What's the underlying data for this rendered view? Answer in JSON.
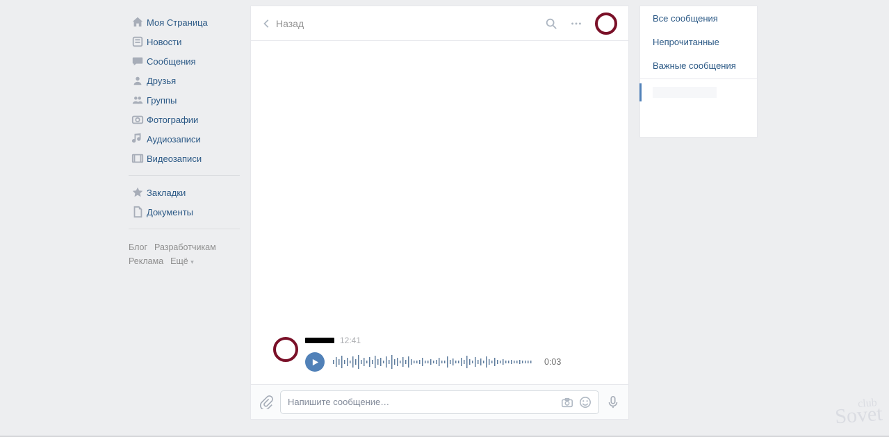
{
  "nav": {
    "items": [
      {
        "label": "Моя Страница",
        "icon": "home-icon"
      },
      {
        "label": "Новости",
        "icon": "feed-icon"
      },
      {
        "label": "Сообщения",
        "icon": "messages-icon"
      },
      {
        "label": "Друзья",
        "icon": "friends-icon"
      },
      {
        "label": "Группы",
        "icon": "groups-icon"
      },
      {
        "label": "Фотографии",
        "icon": "photos-icon"
      },
      {
        "label": "Аудиозаписи",
        "icon": "audio-icon"
      },
      {
        "label": "Видеозаписи",
        "icon": "video-icon"
      }
    ],
    "secondary": [
      {
        "label": "Закладки",
        "icon": "bookmarks-icon"
      },
      {
        "label": "Документы",
        "icon": "documents-icon"
      }
    ],
    "footer": {
      "blog": "Блог",
      "developers": "Разработчикам",
      "ads": "Реклама",
      "more": "Ещё"
    }
  },
  "chat": {
    "back_label": "Назад",
    "title": "",
    "message": {
      "time": "12:41",
      "audio_duration": "0:03"
    },
    "composer": {
      "placeholder": "Напишите сообщение…"
    }
  },
  "filters": {
    "all": "Все сообщения",
    "unread": "Непрочитанные",
    "important": "Важные сообщения",
    "selected": ""
  },
  "watermark": {
    "small": "club",
    "big": "Sovet"
  }
}
